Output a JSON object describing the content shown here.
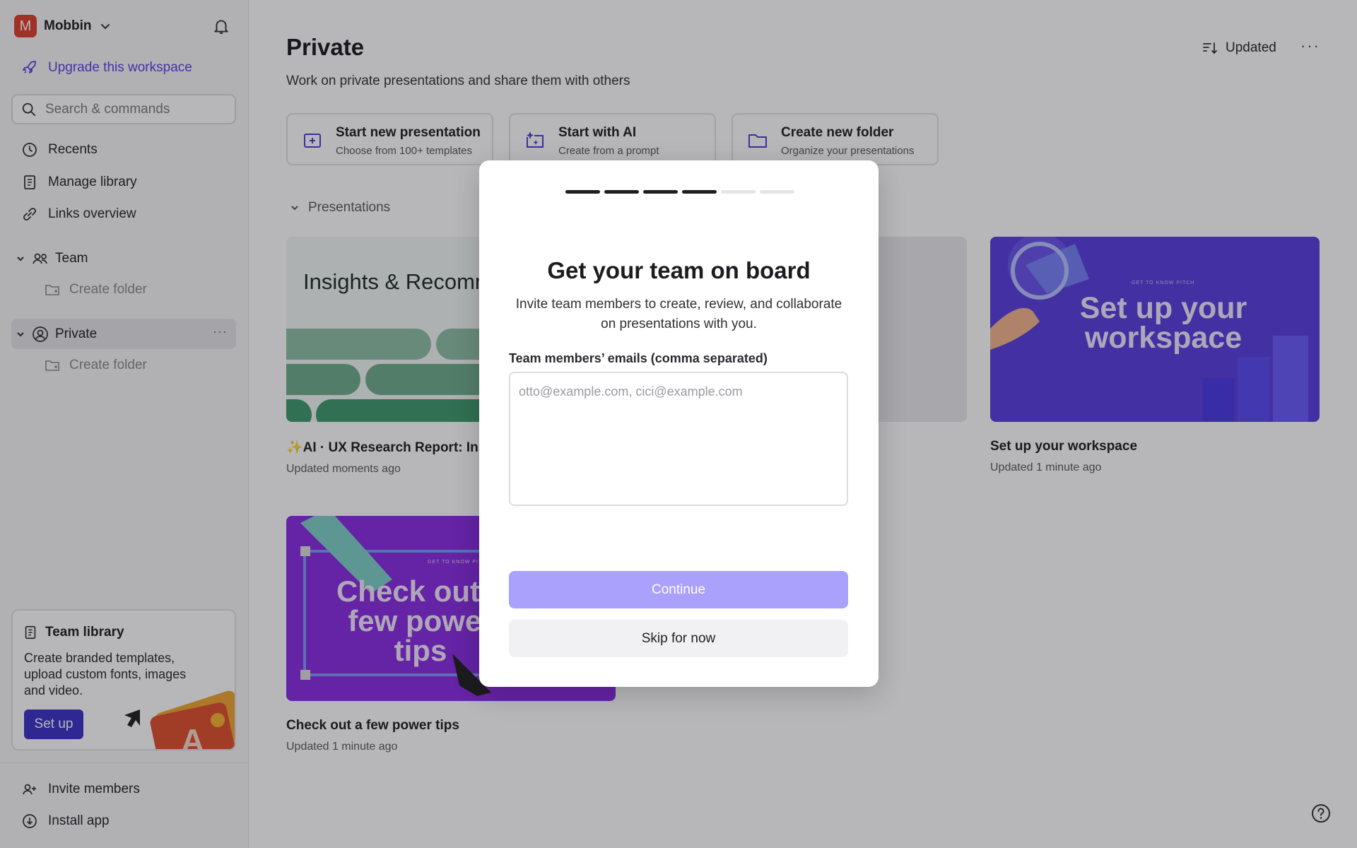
{
  "workspace": {
    "initial": "M",
    "name": "Mobbin"
  },
  "sidebar": {
    "upgrade_label": "Upgrade this workspace",
    "search_placeholder": "Search & commands",
    "nav": [
      {
        "label": "Recents",
        "icon": "clock-icon"
      },
      {
        "label": "Manage library",
        "icon": "book-icon"
      },
      {
        "label": "Links overview",
        "icon": "link-icon"
      }
    ],
    "team": {
      "label": "Team",
      "create_folder": "Create folder"
    },
    "private": {
      "label": "Private",
      "more": "···",
      "create_folder": "Create folder"
    },
    "library_card": {
      "title": "Team library",
      "description": "Create branded templates, upload custom fonts, images and video.",
      "button": "Set up"
    },
    "bottom": [
      {
        "label": "Invite members",
        "icon": "add-user-icon"
      },
      {
        "label": "Install app",
        "icon": "download-icon"
      }
    ]
  },
  "main": {
    "title": "Private",
    "subtitle": "Work on private presentations and share them with others",
    "sort_label": "Updated",
    "more": "···",
    "actions": [
      {
        "title": "Start new presentation",
        "subtitle": "Choose from 100+ templates"
      },
      {
        "title": "Start with AI",
        "subtitle": "Create from a prompt"
      },
      {
        "title": "Create new folder",
        "subtitle": "Organize your presentations"
      }
    ],
    "section_label": "Presentations",
    "cards": [
      {
        "title": "✨AI · UX Research Report: Insights & Recommendations",
        "meta": "Updated moments ago",
        "thumb_text": "Insights & Recommendations"
      },
      {
        "title": "",
        "meta": ""
      },
      {
        "title": "Set up your workspace",
        "meta": "Updated 1 minute ago",
        "thumb_text": "Set up your workspace",
        "thumb_small": "GET TO KNOW PITCH"
      },
      {
        "title": "Check out a few power tips",
        "meta": "Updated 1 minute ago",
        "thumb_text": "Check out a few power tips",
        "thumb_small": "GET TO KNOW PITCH"
      }
    ]
  },
  "modal": {
    "steps_total": 6,
    "steps_done": 4,
    "title": "Get your team on board",
    "description": "Invite team members to create, review, and collaborate on presentations with you.",
    "field_label": "Team members’ emails (comma separated)",
    "field_placeholder": "otto@example.com, cici@example.com",
    "continue_label": "Continue",
    "skip_label": "Skip for now"
  },
  "colors": {
    "accent": "#3d33c9",
    "upgrade": "#5b3fe6",
    "continue_disabled": "#a9a1fb",
    "workspace_avatar": "#e0402f"
  }
}
